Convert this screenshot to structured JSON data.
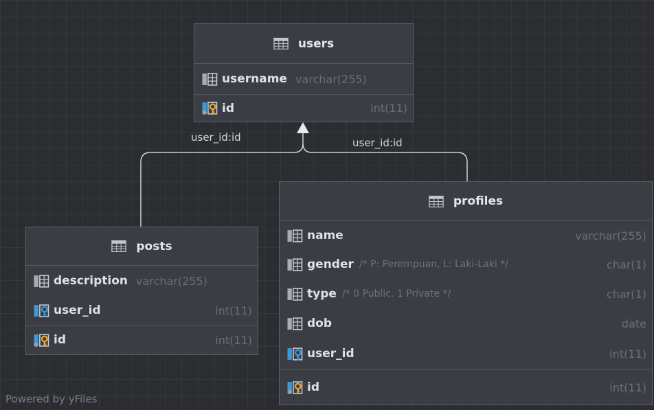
{
  "tables": {
    "users": {
      "title": "users",
      "columns": [
        {
          "name": "username",
          "type": "varchar(255)",
          "icon": "column-icon"
        },
        {
          "name": "id",
          "type": "int(11)",
          "icon": "primary-key-icon"
        }
      ]
    },
    "posts": {
      "title": "posts",
      "columns": [
        {
          "name": "description",
          "type": "varchar(255)",
          "icon": "column-icon"
        },
        {
          "name": "user_id",
          "type": "int(11)",
          "icon": "foreign-key-icon"
        },
        {
          "name": "id",
          "type": "int(11)",
          "icon": "primary-key-icon"
        }
      ]
    },
    "profiles": {
      "title": "profiles",
      "columns": [
        {
          "name": "name",
          "comment": "",
          "type": "varchar(255)",
          "icon": "column-icon"
        },
        {
          "name": "gender",
          "comment": "/* P: Perempuan, L: Laki-Laki */",
          "type": "char(1)",
          "icon": "column-icon"
        },
        {
          "name": "type",
          "comment": "/* 0 Public, 1 Private */",
          "type": "char(1)",
          "icon": "column-icon"
        },
        {
          "name": "dob",
          "comment": "",
          "type": "date",
          "icon": "column-icon"
        },
        {
          "name": "user_id",
          "comment": "",
          "type": "int(11)",
          "icon": "foreign-key-icon"
        },
        {
          "name": "id",
          "comment": "",
          "type": "int(11)",
          "icon": "primary-key-icon"
        }
      ]
    }
  },
  "relations": {
    "posts_users": "user_id:id",
    "profiles_users": "user_id:id"
  },
  "watermark": "Powered by yFiles",
  "colors": {
    "background": "#2b2d31",
    "table_body": "#3a3d43",
    "key_gold": "#e2a93b",
    "key_blue": "#3e9ad6"
  }
}
